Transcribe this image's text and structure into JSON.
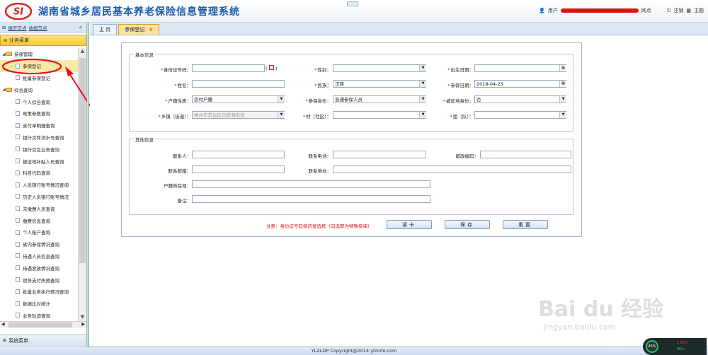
{
  "header": {
    "logo_text": "SI",
    "title": "湖南省城乡居民基本养老保险信息管理系统",
    "user_prefix": "用户",
    "user_site": "网点",
    "logout": "注销",
    "theme": "主题"
  },
  "left": {
    "expand_nodes": "展开节点",
    "collapse_nodes": "收缩节点",
    "menu_header": "业务菜单",
    "system_menu": "系统菜单",
    "tree": [
      {
        "label": "参保管理",
        "type": "folder",
        "depth": 0
      },
      {
        "label": "参保登记",
        "type": "leaf",
        "depth": 1,
        "selected": true
      },
      {
        "label": "批量参保登记",
        "type": "leaf",
        "depth": 1
      },
      {
        "label": "综合查询",
        "type": "folder",
        "depth": 0
      },
      {
        "label": "个人综合查询",
        "type": "leaf",
        "depth": 1
      },
      {
        "label": "政策参数查询",
        "type": "leaf",
        "depth": 1
      },
      {
        "label": "支付单明细查询",
        "type": "leaf",
        "depth": 1
      },
      {
        "label": "银行文件流水号查询",
        "type": "leaf",
        "depth": 1
      },
      {
        "label": "银行交互业务查询",
        "type": "leaf",
        "depth": 1
      },
      {
        "label": "被征地补贴人员查询",
        "type": "leaf",
        "depth": 1
      },
      {
        "label": "科目代码查询",
        "type": "leaf",
        "depth": 1
      },
      {
        "label": "人员银行账号情况查询",
        "type": "leaf",
        "depth": 1
      },
      {
        "label": "历史人员银行账号情况",
        "type": "leaf",
        "depth": 1
      },
      {
        "label": "未缴费人员查询",
        "type": "leaf",
        "depth": 1
      },
      {
        "label": "缴费信息查询",
        "type": "leaf",
        "depth": 1
      },
      {
        "label": "个人账户查询",
        "type": "leaf",
        "depth": 1
      },
      {
        "label": "省内参保情况查询",
        "type": "leaf",
        "depth": 1
      },
      {
        "label": "待遇人员信息查询",
        "type": "leaf",
        "depth": 1
      },
      {
        "label": "待遇发放情况查询",
        "type": "leaf",
        "depth": 1
      },
      {
        "label": "财务支付失败查询",
        "type": "leaf",
        "depth": 1
      },
      {
        "label": "批量业务执行情况查询",
        "type": "leaf",
        "depth": 1
      },
      {
        "label": "数据比对统计",
        "type": "leaf",
        "depth": 1
      },
      {
        "label": "业务轨迹查询",
        "type": "leaf",
        "depth": 1
      }
    ]
  },
  "tabs": [
    {
      "label": "主 页",
      "active": false
    },
    {
      "label": "参保登记",
      "active": true,
      "closable": true
    }
  ],
  "form": {
    "basic_title": "基本信息",
    "other_title": "其他信息",
    "fields": {
      "id_no": {
        "label": "身份证号码：",
        "value": ""
      },
      "gender": {
        "label": "性别：",
        "value": ""
      },
      "birth": {
        "label": "出生日期：",
        "value": ""
      },
      "name": {
        "label": "姓名：",
        "value": ""
      },
      "ethnicity": {
        "label": "民族：",
        "value": "汉族"
      },
      "ins_date": {
        "label": "参保日期：",
        "value": "2018-04-23"
      },
      "hukou_type": {
        "label": "户籍性质：",
        "value": "农村户籍"
      },
      "ins_identity": {
        "label": "参保身份：",
        "value": "普通参保人员"
      },
      "land_identity": {
        "label": "被征地身份：",
        "value": "否"
      },
      "town": {
        "label": "乡镇（街道）：",
        "value": "郴州市苏仙区白鹿洞街道"
      },
      "village": {
        "label": "村（社区）：",
        "value": ""
      },
      "group": {
        "label": "组（队）：",
        "value": ""
      },
      "contact": {
        "label": "联系人：",
        "value": ""
      },
      "phone": {
        "label": "联系电话：",
        "value": ""
      },
      "postcode": {
        "label": "邮政编码：",
        "value": ""
      },
      "email": {
        "label": "联系邮箱：",
        "value": ""
      },
      "address": {
        "label": "联系地址：",
        "value": ""
      },
      "hukou_place": {
        "label": "户籍所在地：",
        "value": ""
      },
      "remark": {
        "label": "备注：",
        "value": ""
      }
    },
    "paren_open": "(",
    "paren_close": ")",
    "note": "注意：身份证号码旁的复选框（勾选即为特殊参保）",
    "btn_read": "读卡",
    "btn_save": "保存",
    "btn_reset": "重置"
  },
  "footer": "YLZLDP Copyright@2014 ylzinfo.com",
  "watermark": {
    "main": "Bai du 经验",
    "sub": "jingyan.baidu.com"
  },
  "net": {
    "pct": "45%",
    "up": "2.8K/s",
    "down": "0K/s"
  },
  "colors": {
    "brand": "#1a5aa6",
    "required": "#e01010",
    "active_tab": "#fbe2a0",
    "menu_header": "#f7c63c"
  }
}
